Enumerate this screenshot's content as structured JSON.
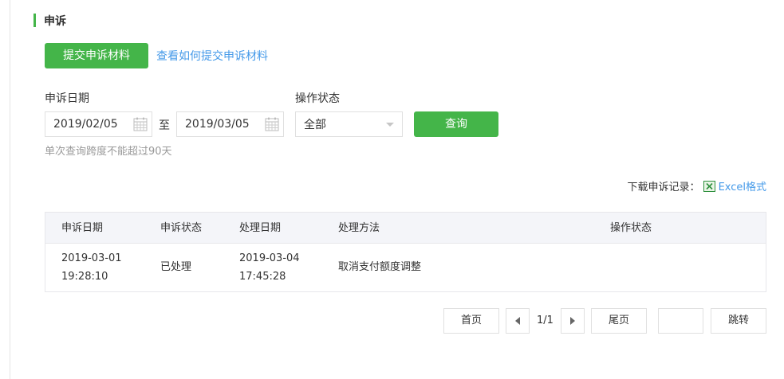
{
  "section": {
    "title": "申诉"
  },
  "actions": {
    "submit_label": "提交申诉材料",
    "howto_link": "查看如何提交申诉材料"
  },
  "filters": {
    "date_label": "申诉日期",
    "date_from": "2019/02/05",
    "separator": "至",
    "date_to": "2019/03/05",
    "status_label": "操作状态",
    "status_value": "全部",
    "query_label": "查询",
    "hint": "单次查询跨度不能超过90天"
  },
  "download": {
    "label": "下载申诉记录：",
    "excel_label": "Excel格式"
  },
  "table": {
    "headers": [
      "申诉日期",
      "申诉状态",
      "处理日期",
      "处理方法",
      "操作状态"
    ],
    "rows": [
      {
        "date_line1": "2019-03-01",
        "date_line2": "19:28:10",
        "status": "已处理",
        "handle_line1": "2019-03-04",
        "handle_line2": "17:45:28",
        "method": "取消支付额度调整",
        "op_status": ""
      }
    ]
  },
  "pagination": {
    "first": "首页",
    "page": "1/1",
    "last": "尾页",
    "jump_input": "",
    "jump": "跳转"
  },
  "colors": {
    "accent": "#44b549",
    "link": "#459ae9",
    "header_bg": "#f4f5f9"
  }
}
